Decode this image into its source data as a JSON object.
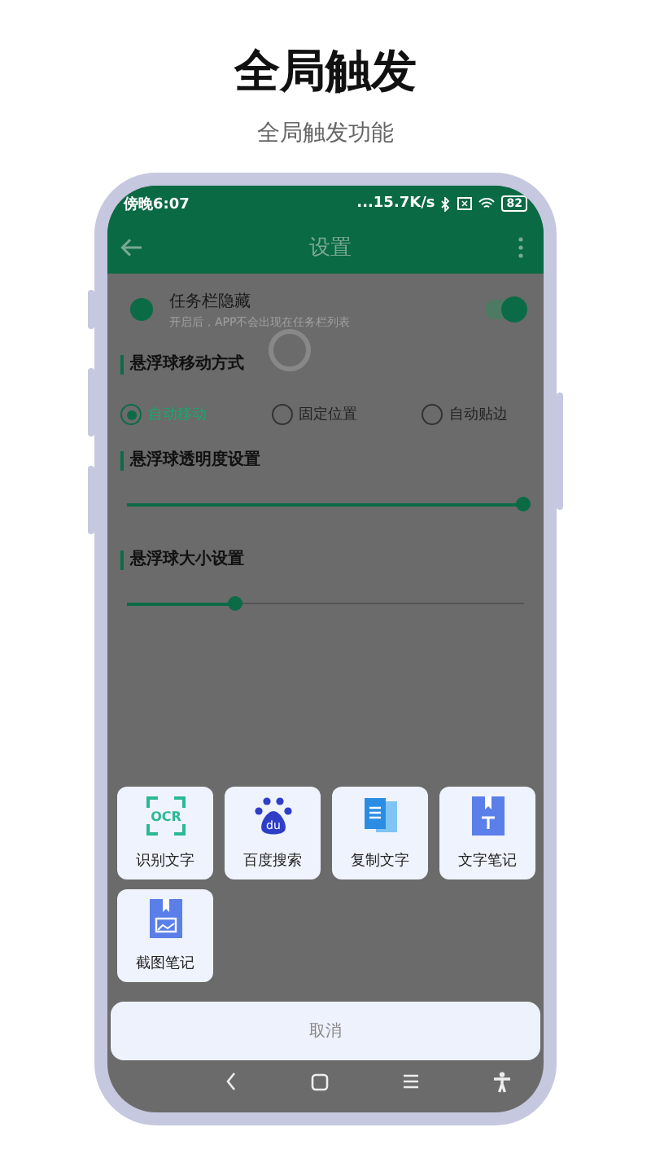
{
  "page": {
    "title": "全局触发",
    "subtitle": "全局触发功能"
  },
  "status_bar": {
    "time": "傍晚6:07",
    "speed": "...15.7K/s",
    "battery": "82"
  },
  "app_bar": {
    "title": "设置"
  },
  "toggle": {
    "title": "任务栏隐藏",
    "description": "开启后，APP不会出现在任务栏列表",
    "on": true
  },
  "move_section": {
    "title": "悬浮球移动方式",
    "options": [
      {
        "label": "自动移动",
        "selected": true
      },
      {
        "label": "固定位置",
        "selected": false
      },
      {
        "label": "自动贴边",
        "selected": false
      }
    ]
  },
  "sliders": [
    {
      "title": "悬浮球透明度设置",
      "level": 1.0
    },
    {
      "title": "悬浮球大小设置",
      "level": 0.27
    }
  ],
  "actions": [
    {
      "label": "识别文字",
      "kind": "ocr",
      "icon_text": "OCR"
    },
    {
      "label": "百度搜索",
      "kind": "paw",
      "icon_text": "du"
    },
    {
      "label": "复制文字",
      "kind": "copy"
    },
    {
      "label": "文字笔记",
      "kind": "text-note"
    },
    {
      "label": "截图笔记",
      "kind": "image-note"
    }
  ],
  "cancel": "取消"
}
